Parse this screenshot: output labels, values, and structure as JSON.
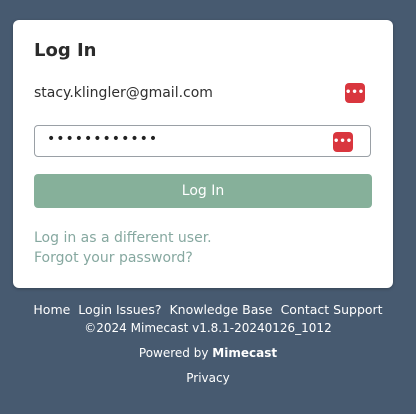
{
  "card": {
    "title": "Log In",
    "email": "stacy.klingler@gmail.com",
    "password_masked": "••••••••••••",
    "password_manager_icon": "password-manager-icon",
    "login_button_label": "Log In",
    "different_user_link": "Log in as a different user.",
    "forgot_password_link": "Forgot your password?"
  },
  "footer": {
    "links": [
      "Home",
      "Login Issues?",
      "Knowledge Base",
      "Contact Support"
    ],
    "copyright": "©2024 Mimecast v1.8.1-20240126_1012",
    "powered_prefix": "Powered by",
    "powered_brand": "Mimecast",
    "privacy": "Privacy"
  },
  "colors": {
    "background": "#475a70",
    "button": "#86b09a",
    "link": "#86a8a0",
    "password_manager": "#d9363e"
  }
}
